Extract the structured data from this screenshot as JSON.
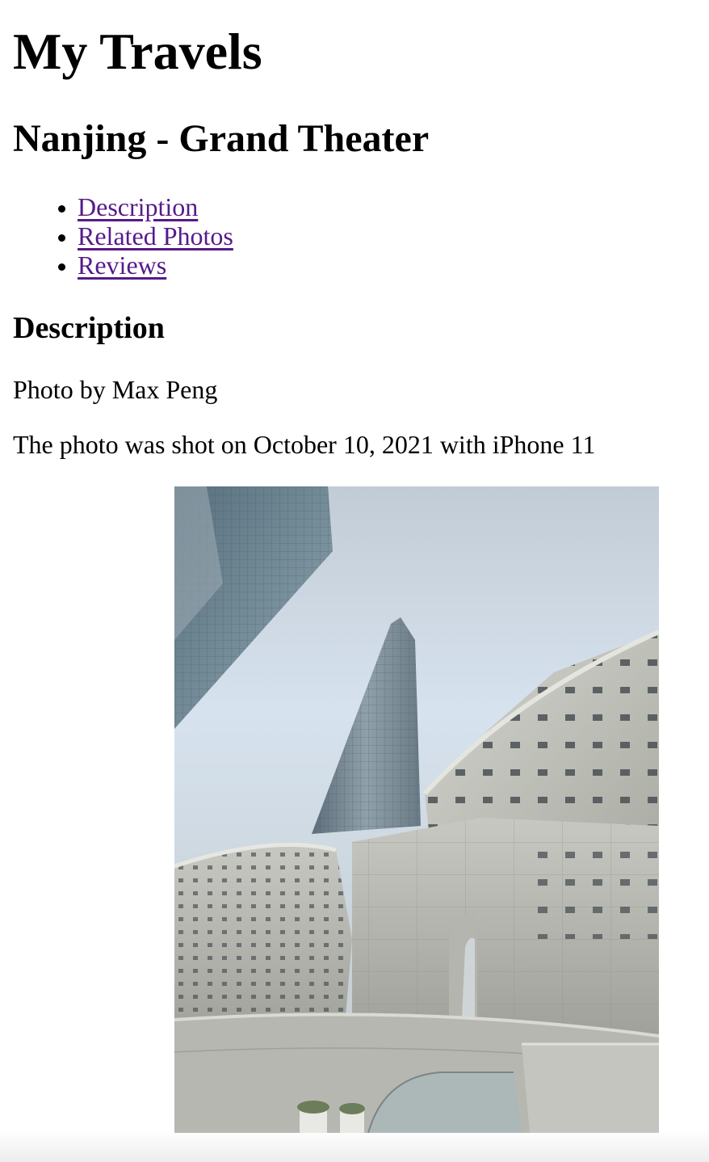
{
  "site_title": "My Travels",
  "page_title": "Nanjing - Grand Theater",
  "nav": [
    {
      "label": "Description"
    },
    {
      "label": "Related Photos"
    },
    {
      "label": "Reviews"
    }
  ],
  "section_heading": "Description",
  "credit": "Photo by Max Peng",
  "shot_info": "The photo was shot on October 10, 2021 with iPhone 11",
  "colors": {
    "link_visited": "#551a8b",
    "text": "#000000",
    "background": "#ffffff"
  }
}
